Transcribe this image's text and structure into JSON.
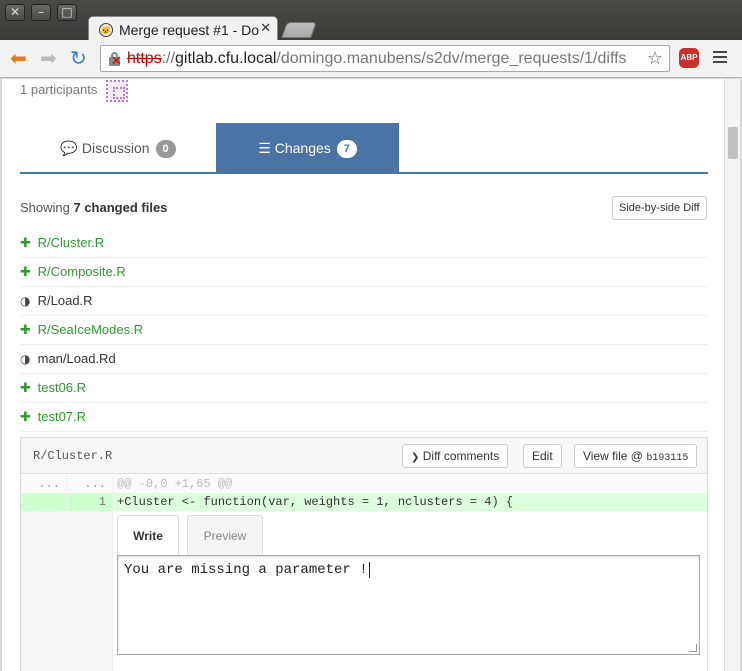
{
  "window": {
    "controls": [
      "✕",
      "–",
      "□"
    ],
    "tab_title": "Merge request #1 - Do",
    "tab_close": "✕"
  },
  "toolbar": {
    "back": "⬅",
    "forward": "➡",
    "reload": "↻",
    "url_scheme": "https",
    "url_sep": "://",
    "url_host": "gitlab.cfu.local",
    "url_path": "/domingo.manubens/s2dv/merge_requests/1/diffs",
    "abp": "ABP"
  },
  "page": {
    "participants": "1 participants",
    "tabs": {
      "discussion": {
        "label": "Discussion",
        "count": "0"
      },
      "changes": {
        "label": "Changes",
        "count": "7"
      }
    },
    "showing_prefix": "Showing ",
    "showing_count": "7 changed files",
    "side_by_side": "Side-by-side Diff",
    "files": [
      {
        "status": "added",
        "icon": "✚",
        "name": "R/Cluster.R"
      },
      {
        "status": "added",
        "icon": "✚",
        "name": "R/Composite.R"
      },
      {
        "status": "modified",
        "icon": "◑",
        "name": "R/Load.R"
      },
      {
        "status": "added",
        "icon": "✚",
        "name": "R/SeaIceModes.R"
      },
      {
        "status": "modified",
        "icon": "◑",
        "name": "man/Load.Rd"
      },
      {
        "status": "added",
        "icon": "✚",
        "name": "test06.R"
      },
      {
        "status": "added",
        "icon": "✚",
        "name": "test07.R"
      }
    ],
    "diff": {
      "filename": "R/Cluster.R",
      "diff_comments": "Diff comments",
      "edit": "Edit",
      "view_file": "View file @",
      "sha": "b193115",
      "lines": [
        {
          "type": "match",
          "old": "...",
          "new": "...",
          "code": "@@ -0,0 +1,65 @@"
        },
        {
          "type": "add",
          "old": "",
          "new": "1",
          "code": "+Cluster <- function(var, weights = 1, nclusters = 4) {"
        }
      ],
      "note": {
        "write_tab": "Write",
        "preview_tab": "Preview",
        "text": "You are missing a parameter !"
      }
    }
  }
}
